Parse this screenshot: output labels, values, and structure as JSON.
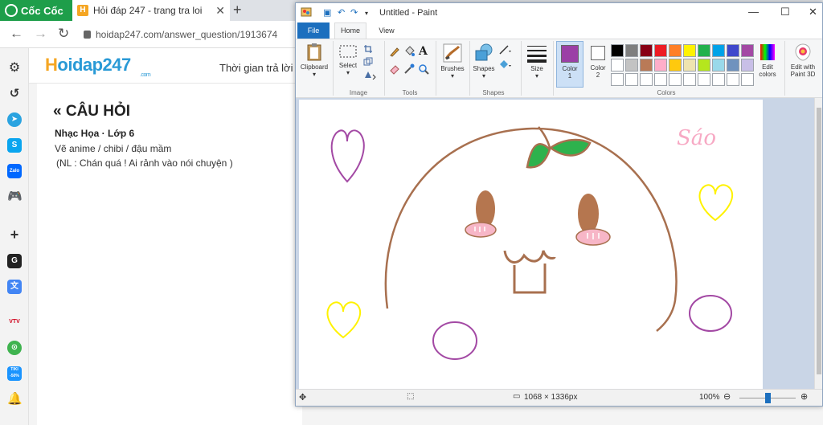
{
  "browser": {
    "brand": "Cốc Cốc",
    "tab_title": "Hỏi đáp 247 - trang tra loi",
    "tab_close": "✕",
    "new_tab": "+",
    "url": "hoidap247.com/answer_question/1913674",
    "sidebar": {
      "zalo": "Zalo",
      "google": "G",
      "viet": "VTV",
      "tiki": "TIKI -50%"
    }
  },
  "site": {
    "logo_h": "H",
    "logo_rest": "oidap247",
    "logo_domain": ".com",
    "slogan": "Thời gian trả lời c"
  },
  "question": {
    "heading": "CÂU HỎI",
    "heading_icon": "«",
    "subject": "Nhạc Họa · Lớp 6",
    "line1": "Vẽ anime / chibi / đậu mầm",
    "line2": "(NL : Chán quá ! Ai rảnh vào nói chuyện )"
  },
  "paint": {
    "title": "Untitled - Paint",
    "tabs": {
      "file": "File",
      "home": "Home",
      "view": "View"
    },
    "groups": {
      "image": "Image",
      "tools": "Tools",
      "shapes": "Shapes",
      "colors": "Colors"
    },
    "buttons": {
      "clipboard": "Clipboard",
      "select": "Select",
      "brushes": "Brushes",
      "shapes": "Shapes",
      "size": "Size",
      "color1_a": "Color",
      "color1_b": "1",
      "color2_a": "Color",
      "color2_b": "2",
      "edit_colors_a": "Edit",
      "edit_colors_b": "colors",
      "edit_3d_a": "Edit with",
      "edit_3d_b": "Paint 3D"
    },
    "colors": {
      "color1": "#9b3fa6",
      "color2": "#ffffff",
      "palette_row1": [
        "#000000",
        "#7f7f7f",
        "#880015",
        "#ed1c24",
        "#ff7f27",
        "#fff200",
        "#22b14c",
        "#00a2e8",
        "#3f48cc",
        "#a349a4"
      ],
      "palette_row2": [
        "#ffffff",
        "#c3c3c3",
        "#b97a57",
        "#ffaec9",
        "#ffc90e",
        "#efe4b0",
        "#b5e61d",
        "#99d9ea",
        "#7092be",
        "#c8bfe7"
      ]
    },
    "canvas_text": "Sáo",
    "status": {
      "dimensions": "1068 × 1336px",
      "zoom": "100%"
    }
  }
}
